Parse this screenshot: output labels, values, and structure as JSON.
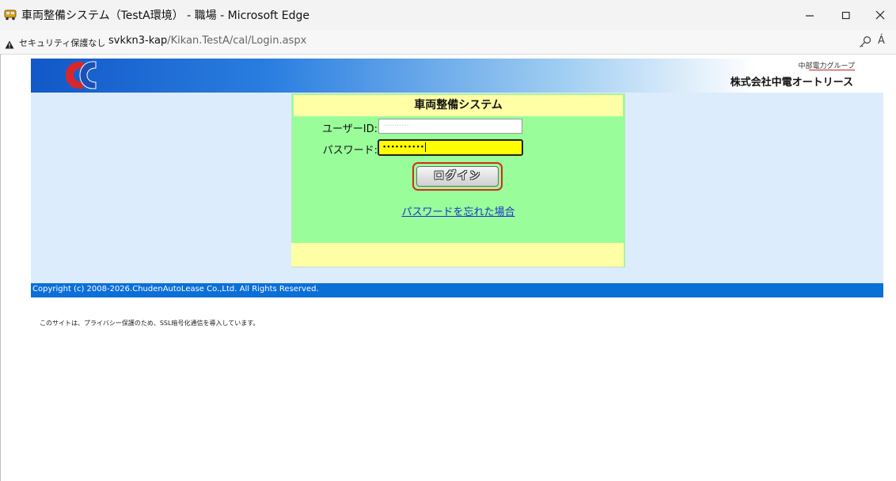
{
  "browser": {
    "window_title": "車両整備システム（TestA環境） - 職場 - Microsoft Edge",
    "security_label": "セキュリティ保護なし",
    "url_host": "svkkn3-kap",
    "url_path": "/Kikan.TestA/cal/Login.aspx",
    "read_aloud_icon": "Á"
  },
  "header": {
    "group_name": "中部電力グループ",
    "company_name": "株式会社中電オートリース"
  },
  "login": {
    "title": "車両整備システム",
    "userid_label": "ユーザーID:",
    "userid_value": "··········",
    "password_label": "パスワード:",
    "password_value": "••••••••••",
    "login_button": "ログイン",
    "forgot_password_link": "パスワードを忘れた場合"
  },
  "footer": {
    "copyright": "Copyright (c) 2008-2026.ChudenAutoLease Co.,Ltd. All Rights Reserved.",
    "ssl_note": "このサイトは、プライバシー保護のため、SSL暗号化通信を導入しています。"
  },
  "colors": {
    "header_blue": "#1258c8",
    "login_green": "#99fd99",
    "login_yellow": "#ffffa6",
    "password_field": "#ffff00",
    "highlight_red": "#d62a20",
    "copyright_bar": "#0b6fd8"
  }
}
